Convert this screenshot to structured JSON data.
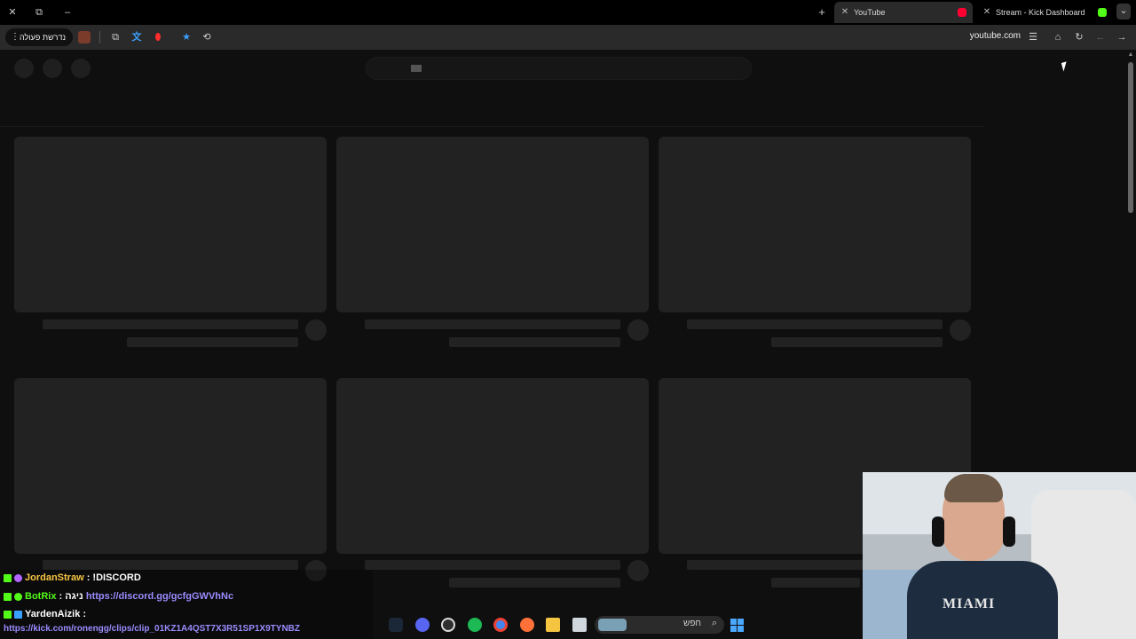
{
  "browser": {
    "window_controls": {
      "close": "✕",
      "restore": "⧉",
      "minimize": "–"
    },
    "new_tab": "+",
    "tabs": [
      {
        "title": "YouTube",
        "active": true,
        "favicon_color": "#ff0033"
      },
      {
        "title": "Stream - Kick Dashboard",
        "active": false,
        "favicon_color": "#53fc18"
      }
    ],
    "tab_list_icon": "chevron-down-icon",
    "toolbar": {
      "action_label": "נדרשת פעולה",
      "url": "youtube.com",
      "extensions": [
        "extension-avatar-icon",
        "puzzle-icon",
        "translate-icon",
        "record-icon"
      ],
      "bookmark_icon": "star-icon",
      "reading_icon": "reading-list-icon"
    }
  },
  "chat": [
    {
      "user": "JordanStraw",
      "separator": " : ",
      "message": "!DISCORD",
      "link": ""
    },
    {
      "user": "BotRix",
      "separator": " : ",
      "message": "ניגה ",
      "link": "https://discord.gg/gcfgGWVhNc"
    },
    {
      "user": "YardenAizik",
      "separator": " :",
      "message": "",
      "link": ""
    }
  ],
  "chat_url": "https://kick.com/ronengg/clips/clip_01KZ1A4QST7X3R51SP1X9TYNBZ",
  "webcam": {
    "shirt_text": "MIAMI"
  },
  "taskbar": {
    "search_text": "חפש",
    "apps": [
      "steam-icon",
      "discord-icon",
      "obs-icon",
      "spotify-icon",
      "chrome-icon",
      "firefox-icon",
      "folder-icon",
      "notepad-icon"
    ]
  },
  "colors": {
    "accent_link": "#9a8cff",
    "kick_green": "#53fc18",
    "youtube_red": "#ff0033"
  }
}
